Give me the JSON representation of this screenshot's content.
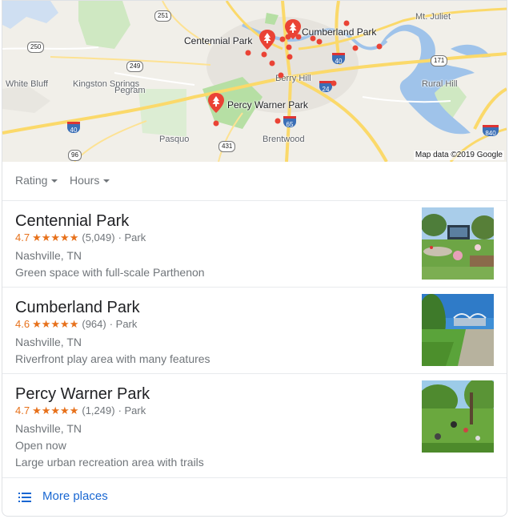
{
  "map": {
    "attribution": "Map data ©2019 Google",
    "places": [
      "Centennial Park",
      "Cumberland Park",
      "Percy Warner Park"
    ],
    "towns": [
      "Mt. Juliet",
      "White Bluff",
      "Kingston Springs",
      "Pegram",
      "Berry Hill",
      "Rural Hill",
      "Pasquo",
      "Brentwood"
    ],
    "routes": [
      "251",
      "250",
      "249",
      "171",
      "96",
      "431"
    ],
    "interstates": [
      "40",
      "24",
      "65",
      "40",
      "840"
    ]
  },
  "filters": {
    "rating": "Rating",
    "hours": "Hours"
  },
  "results": [
    {
      "name": "Centennial Park",
      "rating": "4.7",
      "stars": "★★★★★",
      "reviews": "(5,049)",
      "type": "· Park",
      "location": "Nashville, TN",
      "status": "",
      "description": "Green space with full-scale Parthenon"
    },
    {
      "name": "Cumberland Park",
      "rating": "4.6",
      "stars": "★★★★★",
      "reviews": "(964)",
      "type": "· Park",
      "location": "Nashville, TN",
      "status": "",
      "description": "Riverfront play area with many features"
    },
    {
      "name": "Percy Warner Park",
      "rating": "4.7",
      "stars": "★★★★★",
      "reviews": "(1,249)",
      "type": "· Park",
      "location": "Nashville, TN",
      "status": "Open now",
      "description": "Large urban recreation area with trails"
    }
  ],
  "more_places": "More places",
  "colors": {
    "star": "#e7711b",
    "link": "#1967d2",
    "pin": "#ea4335",
    "water": "#9fc3ea",
    "park": "#b6dfa4",
    "road": "#fbd96a"
  },
  "icons": {
    "pin": "park-pin-icon",
    "more": "list-icon"
  }
}
